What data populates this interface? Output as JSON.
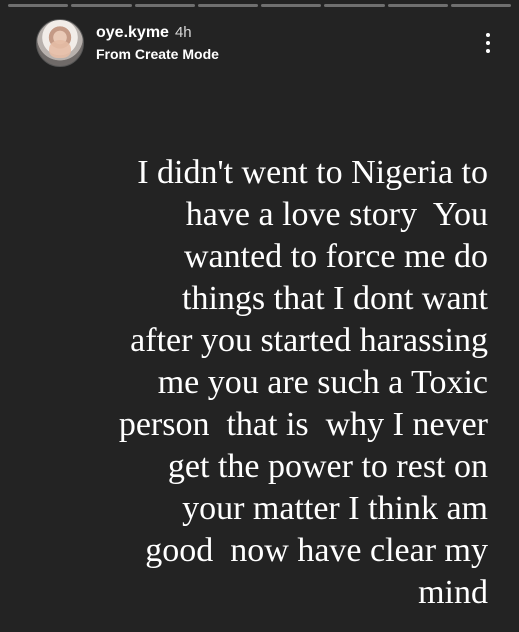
{
  "story": {
    "progress_segments": 8,
    "progress_completed": 0,
    "username": "oye.kyme",
    "time_ago": "4h",
    "subtitle": "From Create Mode",
    "menu_icon": "more-vertical-icon",
    "text_lines": [
      "I didn't went to Nigeria to",
      "have a love story  You",
      "wanted to force me do",
      "things that I dont want",
      "after you started harassing",
      "me you are such a Toxic",
      "person  that is  why I never",
      "get the power to rest on",
      "your matter I think am",
      "good  now have clear my",
      "mind"
    ],
    "colors": {
      "background": "#232323",
      "text": "#ffffff"
    }
  }
}
